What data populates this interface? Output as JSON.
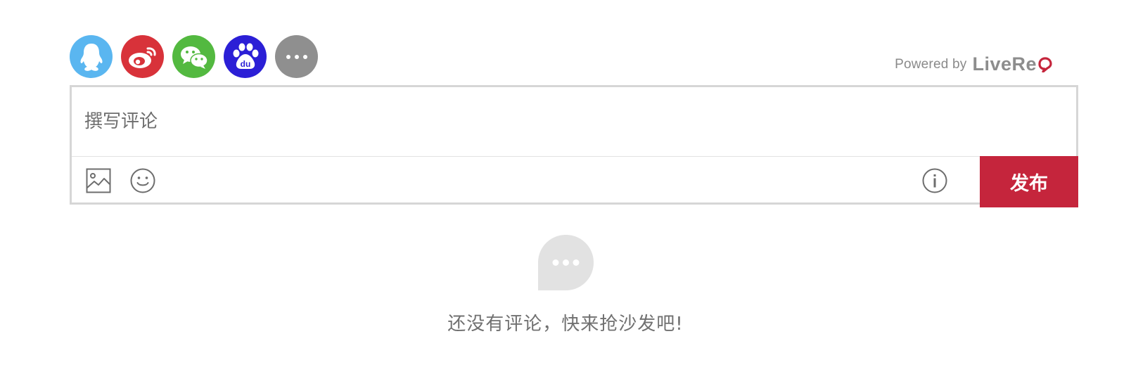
{
  "social_login": {
    "buttons": [
      {
        "name": "qq-icon",
        "color": "#5ab6f0"
      },
      {
        "name": "weibo-icon",
        "color": "#d8323a"
      },
      {
        "name": "wechat-icon",
        "color": "#53b940"
      },
      {
        "name": "baidu-icon",
        "color": "#2b1fd6",
        "label": "du"
      },
      {
        "name": "more-icon",
        "color": "#8f8f8f"
      }
    ]
  },
  "branding": {
    "powered_by": "Powered by",
    "logo_text": "LiveRe",
    "logo_accent_color": "#c5253c"
  },
  "editor": {
    "placeholder": "撰写评论",
    "value": "",
    "toolbar_icons": [
      "image-icon",
      "emoji-icon",
      "info-icon"
    ],
    "submit_label": "发布",
    "submit_color": "#c5253c"
  },
  "empty_state": {
    "icon": "comment-bubble-icon",
    "message": "还没有评论，快来抢沙发吧!"
  }
}
